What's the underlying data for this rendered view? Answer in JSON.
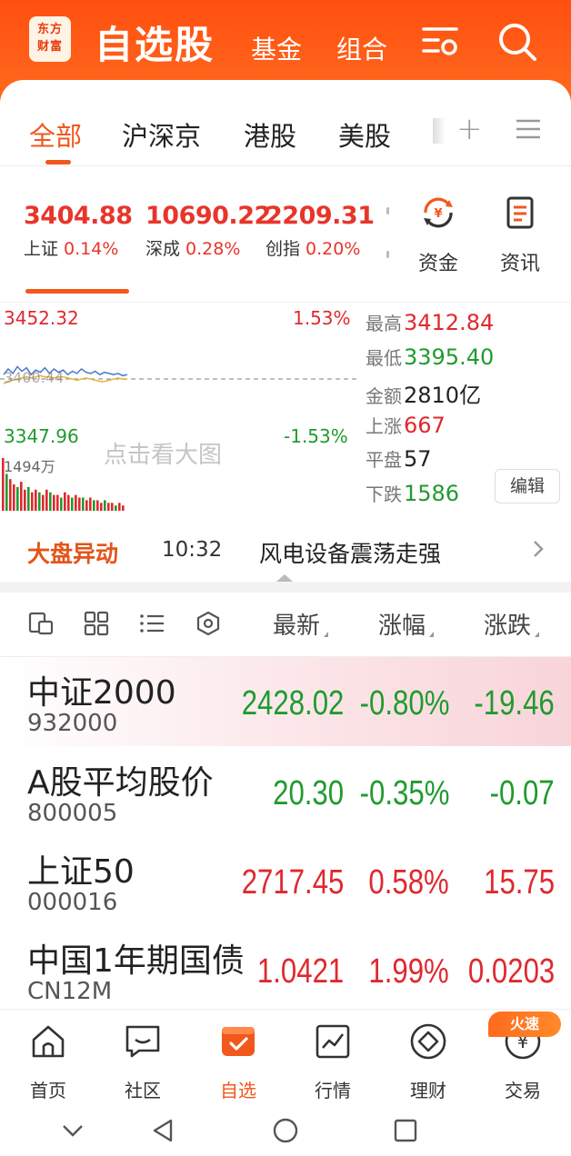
{
  "header": {
    "logo_line1": "东方",
    "logo_line2": "财富",
    "title": "自选股",
    "tabs": [
      "基金",
      "组合"
    ],
    "icons": [
      "filter-settings-icon",
      "search-icon"
    ]
  },
  "market_tabs": {
    "items": [
      "全部",
      "沪深京",
      "港股",
      "美股"
    ],
    "active": "全部"
  },
  "indices": [
    {
      "value": "3404.88",
      "name": "上证",
      "change": "0.14%"
    },
    {
      "value": "10690.22",
      "name": "深成",
      "change": "0.28%"
    },
    {
      "value": "2209.31",
      "name": "创指",
      "change": "0.20%"
    }
  ],
  "quick_links": [
    {
      "label": "资金",
      "icon": "capital-flow-icon"
    },
    {
      "label": "资讯",
      "icon": "news-icon"
    }
  ],
  "mini_chart": {
    "top_price": "3452.32",
    "top_pct": "1.53%",
    "bottom_price": "3347.96",
    "bottom_pct": "-1.53%",
    "base_label": "3400.44",
    "volume_label": "1494万",
    "hint": "点击看大图"
  },
  "chart_data": {
    "type": "line",
    "series": [
      {
        "values": [
          3404,
          3409,
          3405,
          3411,
          3407,
          3410,
          3404,
          3408,
          3406,
          3410,
          3405,
          3409,
          3406,
          3408,
          3404,
          3407,
          3405,
          3409,
          3406,
          3405,
          3407,
          3404,
          3406,
          3405,
          3404,
          3405,
          3403,
          3404
        ]
      },
      {
        "values": [
          3396,
          3398,
          3399,
          3400,
          3401,
          3402,
          3401,
          3402,
          3403,
          3402,
          3402,
          3401,
          3402,
          3402,
          3401,
          3400,
          3399,
          3400,
          3401,
          3400,
          3399,
          3398,
          3398,
          3399,
          3400,
          3401,
          3400,
          3400
        ]
      }
    ],
    "ylim": [
      3347.96,
      3452.32
    ],
    "volume": [
      20,
      14,
      12,
      10,
      9,
      11,
      8,
      9,
      7,
      8,
      7,
      6,
      8,
      7,
      6,
      6,
      5,
      7,
      6,
      5,
      6,
      5,
      5,
      4,
      5,
      4,
      4,
      3,
      4,
      3,
      3,
      2,
      3,
      2
    ]
  },
  "stats": [
    {
      "label": "最高",
      "value": "3412.84",
      "color": "#e0282f"
    },
    {
      "label": "最低",
      "value": "3395.40",
      "color": "#1f9b2e"
    },
    {
      "label": "金额",
      "value": "2810亿",
      "color": "#222222"
    },
    {
      "label": "上涨",
      "value": "667",
      "color": "#e0282f"
    },
    {
      "label": "平盘",
      "value": "57",
      "color": "#222222"
    },
    {
      "label": "下跌",
      "value": "1586",
      "color": "#1f9b2e"
    }
  ],
  "edit_label": "编辑",
  "market_move": {
    "title": "大盘异动",
    "time": "10:32",
    "text": "风电设备震荡走强"
  },
  "list_header": {
    "icons": [
      "quote-card-icon",
      "grid-view-icon",
      "list-view-icon",
      "settings-ring-icon"
    ],
    "columns": [
      "最新",
      "涨幅",
      "涨跌"
    ]
  },
  "stocks": [
    {
      "name": "中证2000",
      "code": "932000",
      "price": "2428.02",
      "pct": "-0.80%",
      "change": "-19.46",
      "trend": "down"
    },
    {
      "name": "A股平均股价",
      "code": "800005",
      "price": "20.30",
      "pct": "-0.35%",
      "change": "-0.07",
      "trend": "down"
    },
    {
      "name": "上证50",
      "code": "000016",
      "price": "2717.45",
      "pct": "0.58%",
      "change": "15.75",
      "trend": "up"
    },
    {
      "name": "中国1年期国债",
      "code": "CN12M",
      "price": "1.0421",
      "pct": "1.99%",
      "change": "0.0203",
      "trend": "up"
    }
  ],
  "bottom_nav": {
    "items": [
      {
        "label": "首页",
        "icon": "home-icon"
      },
      {
        "label": "社区",
        "icon": "community-chat-icon"
      },
      {
        "label": "自选",
        "icon": "watchlist-check-icon"
      },
      {
        "label": "行情",
        "icon": "market-chart-icon"
      },
      {
        "label": "理财",
        "icon": "wealth-diamond-icon"
      },
      {
        "label": "交易",
        "icon": "trade-yuan-icon"
      }
    ],
    "active": "自选",
    "badge": "火速"
  },
  "colors": {
    "brand": "#f2571c",
    "up": "#e0282f",
    "down": "#1f9b2e"
  }
}
